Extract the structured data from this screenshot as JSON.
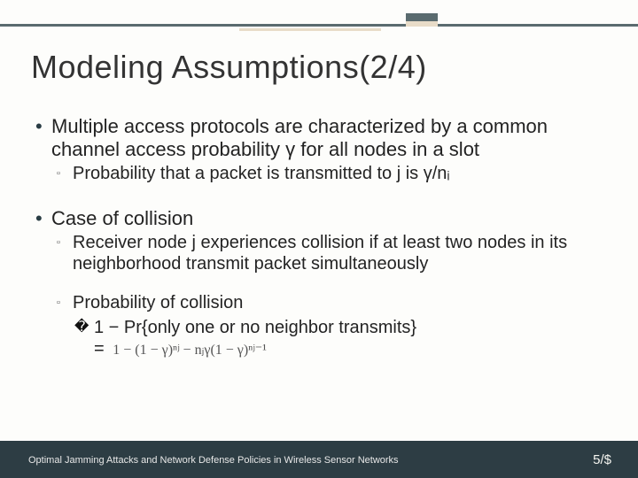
{
  "slide": {
    "title": "Modeling Assumptions(2/4)"
  },
  "bullets": {
    "b1": "Multiple access protocols are characterized by a common channel access probability γ for all nodes in a slot",
    "b1a": "Probability that a packet is transmitted to j is γ/nᵢ",
    "b2": "Case of collision",
    "b2a": "Receiver node j experiences collision if at least two nodes in its neighborhood transmit packet simultaneously",
    "b2b": "Probability of collision",
    "b2b1": "1 − Pr{only one or no neighbor transmits}",
    "b2b1_eq": "="
  },
  "formula": {
    "text": "1 − (1 − γ)ⁿʲ − nⱼγ(1 − γ)ⁿʲ⁻¹"
  },
  "footer": {
    "left": "Optimal Jamming Attacks and Network Defense Policies in Wireless Sensor Networks",
    "right": "5/$"
  },
  "glyphs": {
    "dot": "•",
    "square": "▫",
    "box": "� "
  }
}
